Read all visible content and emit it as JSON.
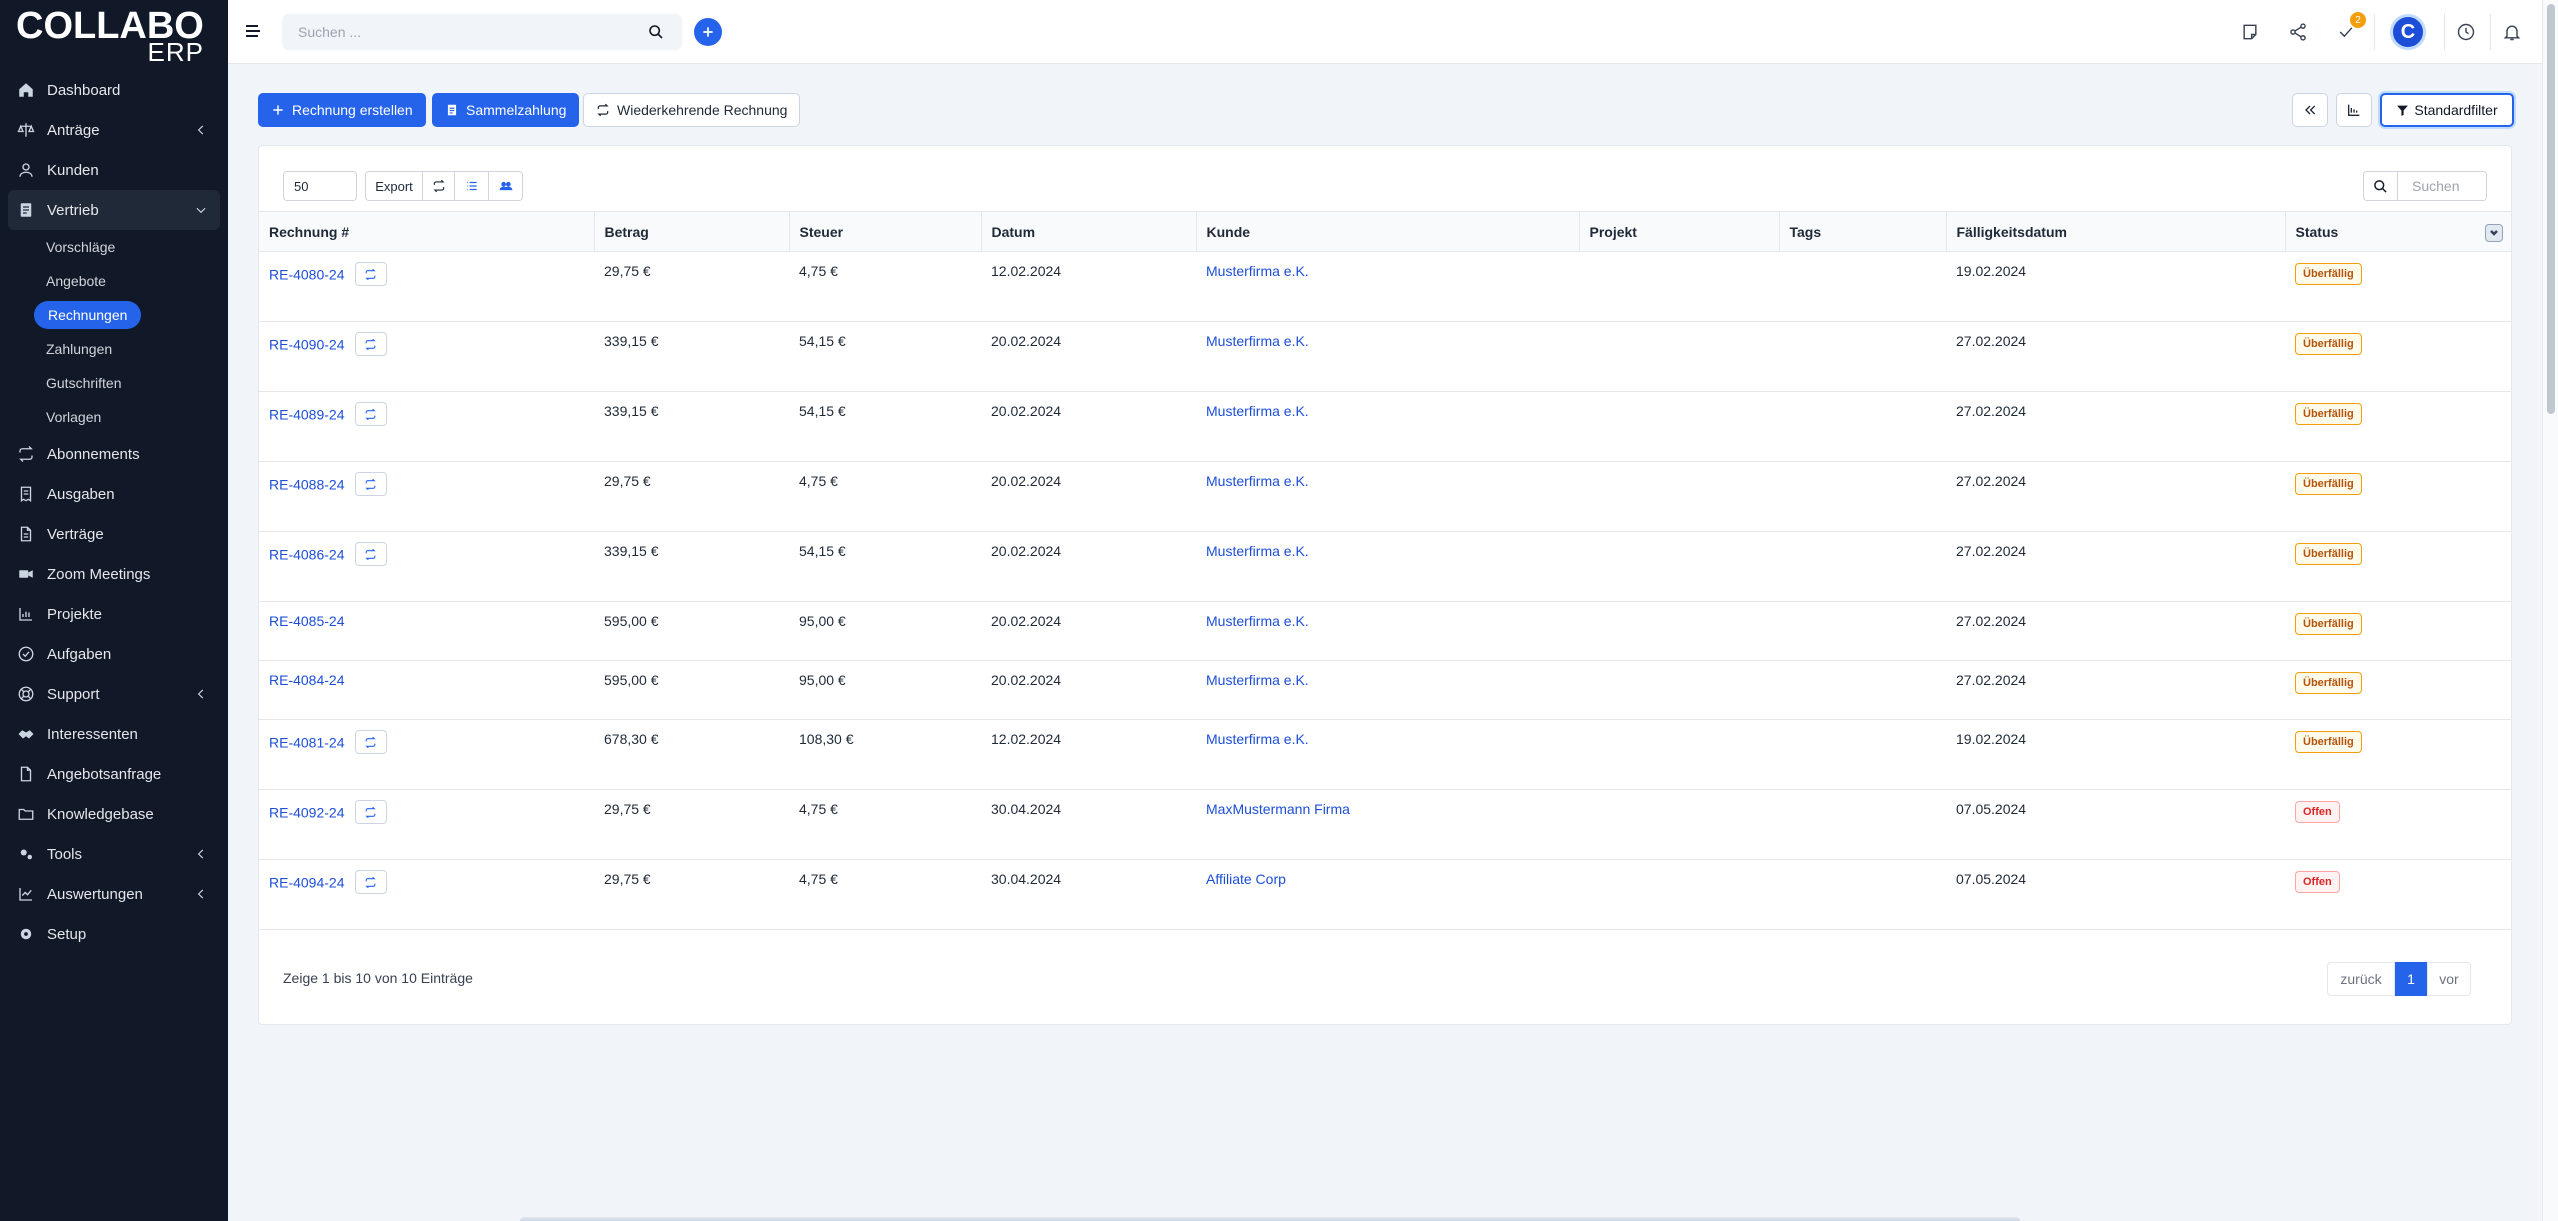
{
  "brand": {
    "line1": "COLLABO",
    "line2": "ERP"
  },
  "colors": {
    "sidebar": "#111827",
    "accent": "#2563eb",
    "overdue": "#b45309",
    "open": "#dc2626"
  },
  "sidebar": {
    "items": [
      {
        "label": "Dashboard",
        "icon": "home-icon"
      },
      {
        "label": "Anträge",
        "icon": "scale-icon",
        "chevron": true
      },
      {
        "label": "Kunden",
        "icon": "user-icon"
      },
      {
        "label": "Vertrieb",
        "icon": "document-icon",
        "expanded": true
      },
      {
        "label": "Abonnements",
        "icon": "repeat-icon"
      },
      {
        "label": "Ausgaben",
        "icon": "receipt-icon"
      },
      {
        "label": "Verträge",
        "icon": "file-icon"
      },
      {
        "label": "Zoom Meetings",
        "icon": "video-icon"
      },
      {
        "label": "Projekte",
        "icon": "chart-icon"
      },
      {
        "label": "Aufgaben",
        "icon": "check-circle-icon"
      },
      {
        "label": "Support",
        "icon": "lifebuoy-icon",
        "chevron": true
      },
      {
        "label": "Interessenten",
        "icon": "handshake-icon"
      },
      {
        "label": "Angebotsanfrage",
        "icon": "file-icon"
      },
      {
        "label": "Knowledgebase",
        "icon": "folder-icon"
      },
      {
        "label": "Tools",
        "icon": "cogs-icon",
        "chevron": true
      },
      {
        "label": "Auswertungen",
        "icon": "chart-icon",
        "chevron": true
      },
      {
        "label": "Setup",
        "icon": "gear-icon"
      }
    ],
    "sub_items": [
      "Vorschläge",
      "Angebote",
      "Rechnungen",
      "Zahlungen",
      "Gutschriften",
      "Vorlagen"
    ]
  },
  "topbar": {
    "search_placeholder": "Suchen ...",
    "tasks_count": "2",
    "avatar_letter": "C"
  },
  "actions": {
    "create": "Rechnung erstellen",
    "batch": "Sammelzahlung",
    "recurring": "Wiederkehrende Rechnung",
    "filter": "Standardfilter"
  },
  "table_tools": {
    "page_length": "50",
    "export": "Export",
    "search_placeholder": "Suchen"
  },
  "table": {
    "headers": [
      "Rechnung #",
      "Betrag",
      "Steuer",
      "Datum",
      "Kunde",
      "Projekt",
      "Tags",
      "Fälligkeitsdatum",
      "Status"
    ],
    "rows": [
      {
        "nr": "RE-4080-24",
        "recurring": true,
        "betrag": "29,75 €",
        "steuer": "4,75 €",
        "datum": "12.02.2024",
        "kunde": "Musterfirma e.K.",
        "faellig": "19.02.2024",
        "status": "Überfällig"
      },
      {
        "nr": "RE-4090-24",
        "recurring": true,
        "betrag": "339,15 €",
        "steuer": "54,15 €",
        "datum": "20.02.2024",
        "kunde": "Musterfirma e.K.",
        "faellig": "27.02.2024",
        "status": "Überfällig"
      },
      {
        "nr": "RE-4089-24",
        "recurring": true,
        "betrag": "339,15 €",
        "steuer": "54,15 €",
        "datum": "20.02.2024",
        "kunde": "Musterfirma e.K.",
        "faellig": "27.02.2024",
        "status": "Überfällig"
      },
      {
        "nr": "RE-4088-24",
        "recurring": true,
        "betrag": "29,75 €",
        "steuer": "4,75 €",
        "datum": "20.02.2024",
        "kunde": "Musterfirma e.K.",
        "faellig": "27.02.2024",
        "status": "Überfällig"
      },
      {
        "nr": "RE-4086-24",
        "recurring": true,
        "betrag": "339,15 €",
        "steuer": "54,15 €",
        "datum": "20.02.2024",
        "kunde": "Musterfirma e.K.",
        "faellig": "27.02.2024",
        "status": "Überfällig"
      },
      {
        "nr": "RE-4085-24",
        "recurring": false,
        "betrag": "595,00 €",
        "steuer": "95,00 €",
        "datum": "20.02.2024",
        "kunde": "Musterfirma e.K.",
        "faellig": "27.02.2024",
        "status": "Überfällig"
      },
      {
        "nr": "RE-4084-24",
        "recurring": false,
        "betrag": "595,00 €",
        "steuer": "95,00 €",
        "datum": "20.02.2024",
        "kunde": "Musterfirma e.K.",
        "faellig": "27.02.2024",
        "status": "Überfällig"
      },
      {
        "nr": "RE-4081-24",
        "recurring": true,
        "betrag": "678,30 €",
        "steuer": "108,30 €",
        "datum": "12.02.2024",
        "kunde": "Musterfirma e.K.",
        "faellig": "19.02.2024",
        "status": "Überfällig"
      },
      {
        "nr": "RE-4092-24",
        "recurring": true,
        "betrag": "29,75 €",
        "steuer": "4,75 €",
        "datum": "30.04.2024",
        "kunde": "MaxMustermann Firma",
        "faellig": "07.05.2024",
        "status": "Offen"
      },
      {
        "nr": "RE-4094-24",
        "recurring": true,
        "betrag": "29,75 €",
        "steuer": "4,75 €",
        "datum": "30.04.2024",
        "kunde": "Affiliate Corp",
        "faellig": "07.05.2024",
        "status": "Offen"
      }
    ]
  },
  "footer": {
    "info": "Zeige 1 bis 10 von 10 Einträge",
    "prev": "zurück",
    "page": "1",
    "next": "vor"
  }
}
